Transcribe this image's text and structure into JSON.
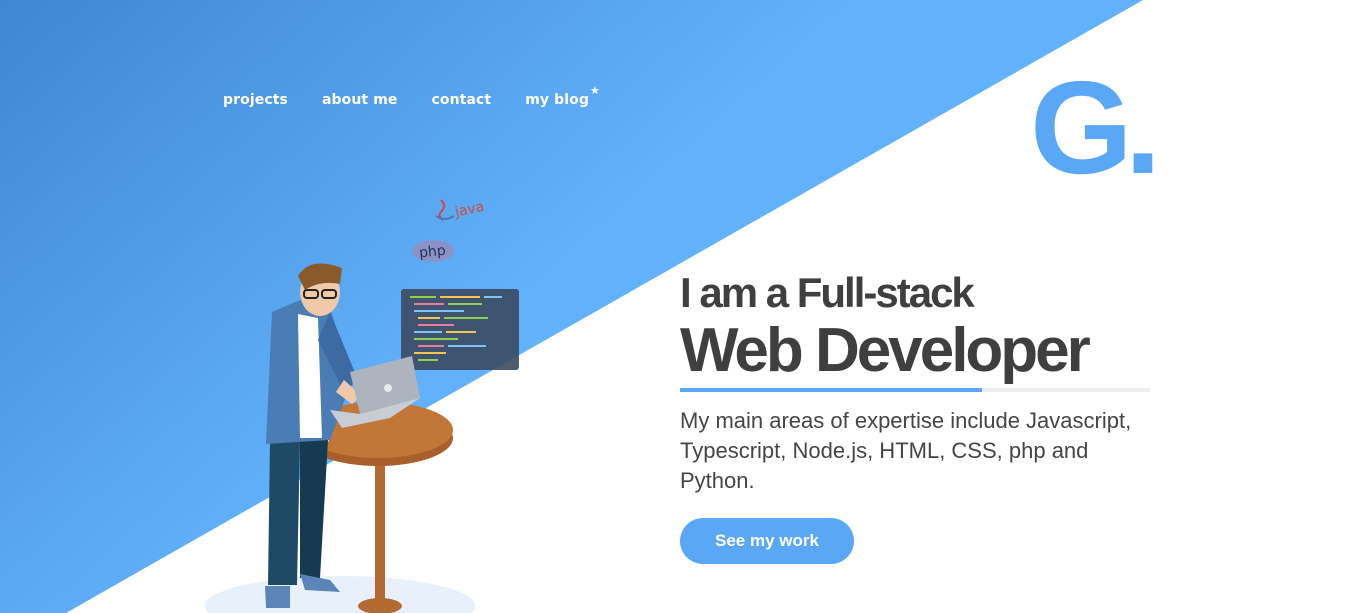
{
  "nav": {
    "items": [
      {
        "label": "projects"
      },
      {
        "label": "about me"
      },
      {
        "label": "contact"
      },
      {
        "label": "my blog"
      }
    ]
  },
  "logo": {
    "text": "G."
  },
  "hero": {
    "line1": "I am a Full-stack",
    "line2": "Web Developer",
    "description": "My main areas of expertise include Javascript, Typescript, Node.js, HTML, CSS, php and Python.",
    "cta_label": "See my work"
  },
  "illustration": {
    "badge_java": "java",
    "badge_php": "php"
  },
  "colors": {
    "accent": "#5aa8f5",
    "gradient_start": "#3f86d4",
    "gradient_end": "#62b1fb",
    "heading": "#3f3f3f",
    "body_text": "#454545"
  }
}
